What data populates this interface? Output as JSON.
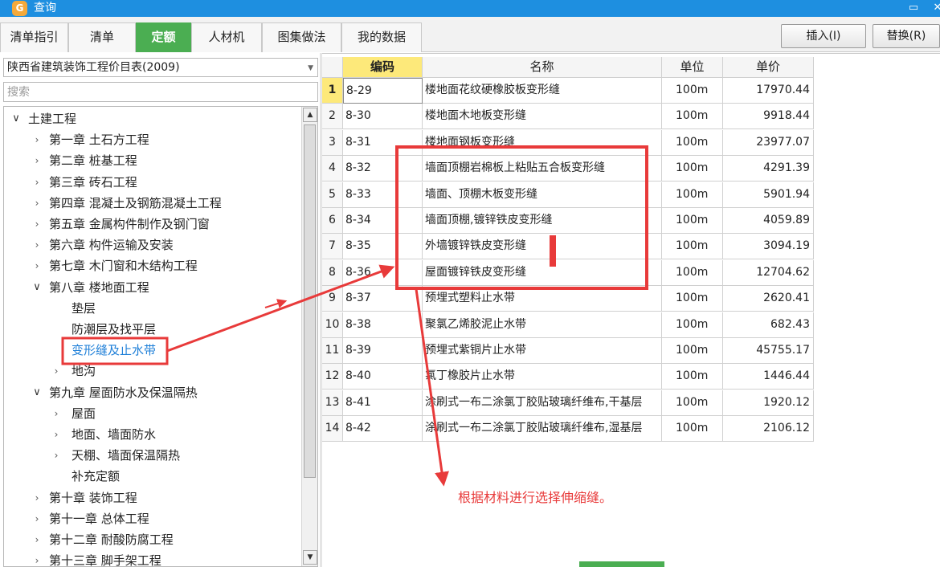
{
  "window": {
    "icon": "glodon-logo-icon",
    "title": "查询",
    "minimize": "▭",
    "close": "✕"
  },
  "tabs": [
    {
      "label": "清单指引",
      "active": false
    },
    {
      "label": "清单",
      "active": false
    },
    {
      "label": "定额",
      "active": true
    },
    {
      "label": "人材机",
      "active": false
    },
    {
      "label": "图集做法",
      "active": false
    },
    {
      "label": "我的数据",
      "active": false
    }
  ],
  "actions": {
    "insert": "插入(I)",
    "replace": "替换(R)"
  },
  "left": {
    "library": "陕西省建筑装饰工程价目表(2009)",
    "search_placeholder": "搜索",
    "tree": [
      {
        "label": "土建工程",
        "level": 0,
        "state": "open"
      },
      {
        "label": "第一章 土石方工程",
        "level": 1,
        "state": "closed"
      },
      {
        "label": "第二章 桩基工程",
        "level": 1,
        "state": "closed"
      },
      {
        "label": "第三章 砖石工程",
        "level": 1,
        "state": "closed"
      },
      {
        "label": "第四章 混凝土及钢筋混凝土工程",
        "level": 1,
        "state": "closed"
      },
      {
        "label": "第五章 金属构件制作及钢门窗",
        "level": 1,
        "state": "closed"
      },
      {
        "label": "第六章 构件运输及安装",
        "level": 1,
        "state": "closed"
      },
      {
        "label": "第七章 木门窗和木结构工程",
        "level": 1,
        "state": "closed"
      },
      {
        "label": "第八章 楼地面工程",
        "level": 1,
        "state": "open"
      },
      {
        "label": "垫层",
        "level": 2,
        "state": "leaf"
      },
      {
        "label": "防潮层及找平层",
        "level": 2,
        "state": "leaf"
      },
      {
        "label": "变形缝及止水带",
        "level": 2,
        "state": "leaf",
        "selected": true
      },
      {
        "label": "地沟",
        "level": 2,
        "state": "closed"
      },
      {
        "label": "第九章 屋面防水及保温隔热",
        "level": 1,
        "state": "open"
      },
      {
        "label": "屋面",
        "level": 2,
        "state": "closed"
      },
      {
        "label": "地面、墙面防水",
        "level": 2,
        "state": "closed"
      },
      {
        "label": "天棚、墙面保温隔热",
        "level": 2,
        "state": "closed"
      },
      {
        "label": "补充定额",
        "level": 2,
        "state": "leaf"
      },
      {
        "label": "第十章 装饰工程",
        "level": 1,
        "state": "closed"
      },
      {
        "label": "第十一章 总体工程",
        "level": 1,
        "state": "closed"
      },
      {
        "label": "第十二章 耐酸防腐工程",
        "level": 1,
        "state": "closed"
      },
      {
        "label": "第十三章 脚手架工程",
        "level": 1,
        "state": "closed"
      }
    ]
  },
  "grid": {
    "headers": {
      "code": "编码",
      "name": "名称",
      "unit": "单位",
      "price": "单价"
    },
    "rows": [
      {
        "no": "1",
        "code": "8-29",
        "name": "楼地面花纹硬橡胶板变形缝",
        "unit": "100m",
        "price": "17970.44"
      },
      {
        "no": "2",
        "code": "8-30",
        "name": "楼地面木地板变形缝",
        "unit": "100m",
        "price": "9918.44"
      },
      {
        "no": "3",
        "code": "8-31",
        "name": "楼地面钢板变形缝",
        "unit": "100m",
        "price": "23977.07"
      },
      {
        "no": "4",
        "code": "8-32",
        "name": "墙面顶棚岩棉板上粘贴五合板变形缝",
        "unit": "100m",
        "price": "4291.39"
      },
      {
        "no": "5",
        "code": "8-33",
        "name": "墙面、顶棚木板变形缝",
        "unit": "100m",
        "price": "5901.94"
      },
      {
        "no": "6",
        "code": "8-34",
        "name": "墙面顶棚,镀锌铁皮变形缝",
        "unit": "100m",
        "price": "4059.89"
      },
      {
        "no": "7",
        "code": "8-35",
        "name": "外墙镀锌铁皮变形缝",
        "unit": "100m",
        "price": "3094.19"
      },
      {
        "no": "8",
        "code": "8-36",
        "name": "屋面镀锌铁皮变形缝",
        "unit": "100m",
        "price": "12704.62"
      },
      {
        "no": "9",
        "code": "8-37",
        "name": "预埋式塑料止水带",
        "unit": "100m",
        "price": "2620.41"
      },
      {
        "no": "10",
        "code": "8-38",
        "name": "聚氯乙烯胶泥止水带",
        "unit": "100m",
        "price": "682.43"
      },
      {
        "no": "11",
        "code": "8-39",
        "name": "预埋式紫铜片止水带",
        "unit": "100m",
        "price": "45755.17"
      },
      {
        "no": "12",
        "code": "8-40",
        "name": "氯丁橡胶片止水带",
        "unit": "100m",
        "price": "1446.44"
      },
      {
        "no": "13",
        "code": "8-41",
        "name": "涂刷式一布二涂氯丁胶贴玻璃纤维布,干基层",
        "unit": "100m",
        "price": "1920.12"
      },
      {
        "no": "14",
        "code": "8-42",
        "name": "涂刷式一布二涂氯丁胶贴玻璃纤维布,湿基层",
        "unit": "100m",
        "price": "2106.12"
      }
    ]
  },
  "annotation": {
    "note": "根据材料进行选择伸缩缝。",
    "color": "#e83a3a"
  }
}
